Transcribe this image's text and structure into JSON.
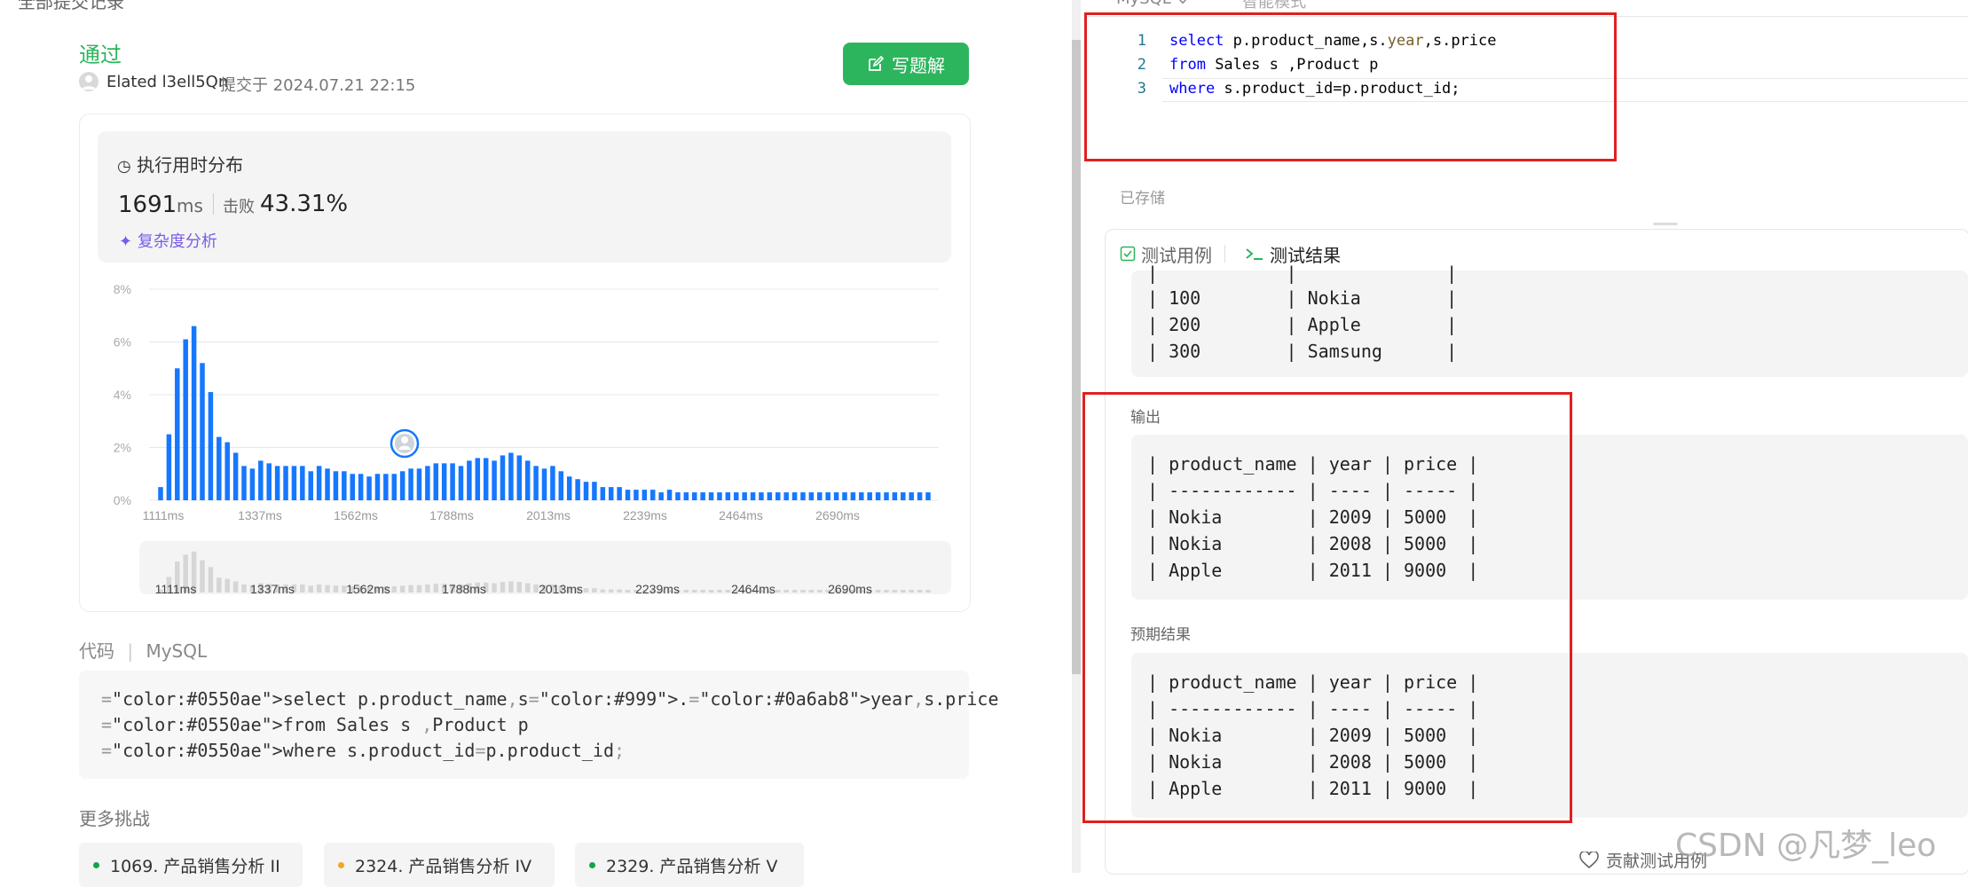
{
  "header": {
    "title": "全部提交记录"
  },
  "submission": {
    "status": "通过",
    "user": "Elated l3ell5Qn",
    "submitted_at": "提交于 2024.07.21 22:15",
    "solution_button": "写题解"
  },
  "runtime": {
    "title": "执行用时分布",
    "ms_value": "1691",
    "ms_unit": "ms",
    "beat_label": "击败",
    "beat_pct": "43.31%",
    "complexity_link": "复杂度分析"
  },
  "chart_data": {
    "type": "bar",
    "x_tick_labels": [
      "1111ms",
      "1337ms",
      "1562ms",
      "1788ms",
      "2013ms",
      "2239ms",
      "2464ms",
      "2690ms"
    ],
    "y_tick_labels": [
      "0%",
      "2%",
      "4%",
      "6%",
      "8%"
    ],
    "ylim": [
      0,
      8
    ],
    "values": [
      0.5,
      2.5,
      5.0,
      6.1,
      6.6,
      5.2,
      4.1,
      2.4,
      2.2,
      1.8,
      1.3,
      1.2,
      1.5,
      1.4,
      1.3,
      1.3,
      1.3,
      1.3,
      1.1,
      1.3,
      1.2,
      1.1,
      1.1,
      1.0,
      1.0,
      0.9,
      1.0,
      1.0,
      1.0,
      1.1,
      1.2,
      1.2,
      1.3,
      1.4,
      1.4,
      1.4,
      1.3,
      1.5,
      1.6,
      1.6,
      1.5,
      1.7,
      1.8,
      1.7,
      1.5,
      1.3,
      1.2,
      1.3,
      1.1,
      0.9,
      0.8,
      0.7,
      0.7,
      0.5,
      0.5,
      0.5,
      0.4,
      0.4,
      0.4,
      0.4,
      0.3,
      0.4,
      0.3,
      0.3,
      0.3,
      0.3,
      0.3,
      0.3,
      0.3,
      0.3,
      0.3,
      0.3,
      0.3,
      0.3,
      0.3,
      0.3,
      0.3,
      0.3,
      0.3,
      0.3,
      0.3,
      0.3,
      0.3,
      0.3,
      0.3,
      0.3,
      0.3,
      0.3,
      0.3,
      0.3,
      0.3,
      0.3,
      0.3
    ],
    "highlight_index": 26,
    "bar_color": "#1677ff",
    "grid": true
  },
  "code_section": {
    "label": "代码",
    "language": "MySQL",
    "lines": [
      "select p.product_name,s.year,s.price",
      "from Sales s ,Product p",
      "where s.product_id=p.product_id;"
    ]
  },
  "more": {
    "title": "更多挑战",
    "items": [
      {
        "label": "1069. 产品销售分析 II",
        "color": "#16a34a"
      },
      {
        "label": "2324. 产品销售分析 IV",
        "color": "#f5a623"
      },
      {
        "label": "2329. 产品销售分析 V",
        "color": "#16a34a"
      }
    ]
  },
  "editor": {
    "language": "MySQL ⌄",
    "mode": "智能模式",
    "line_numbers": [
      "1",
      "2",
      "3"
    ],
    "saved": "已存储"
  },
  "results": {
    "tab_cases": "测试用例",
    "tab_results": "测试结果",
    "input_rows": [
      "| 100        | Nokia        |",
      "| 200        | Apple        |",
      "| 300        | Samsung      |"
    ],
    "output_label": "输出",
    "output_table": "| product_name | year | price |\n| ------------ | ---- | ----- |\n| Nokia        | 2009 | 5000  |\n| Nokia        | 2008 | 5000  |\n| Apple        | 2011 | 9000  |",
    "expected_label": "预期结果",
    "expected_table": "| product_name | year | price |\n| ------------ | ---- | ----- |\n| Nokia        | 2009 | 5000  |\n| Nokia        | 2008 | 5000  |\n| Apple        | 2011 | 9000  |",
    "contribute": "贡献测试用例"
  },
  "watermark": "CSDN @凡梦_leo",
  "colors": {
    "accent_green": "#2db55d",
    "highlight_red": "#e02020",
    "bar_blue": "#1677ff"
  }
}
